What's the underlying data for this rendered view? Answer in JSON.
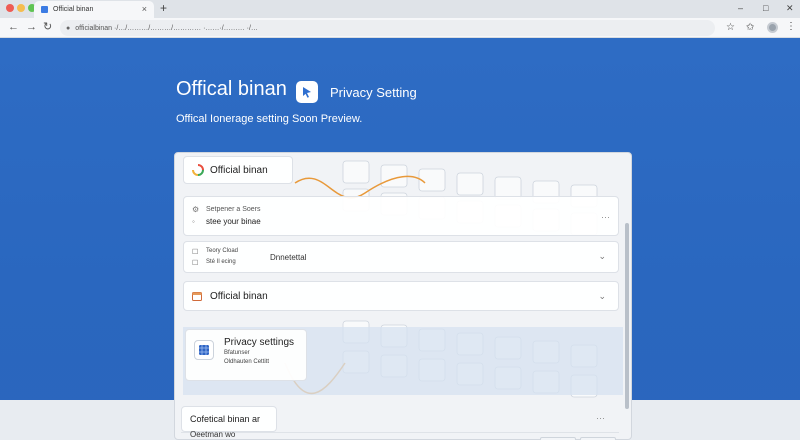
{
  "browser": {
    "tab_title": "Official binan",
    "new_tab_glyph": "+",
    "tab_close_glyph": "×",
    "url": "officialbinan ·/…/………/………/………… ·……·/……… ·/…",
    "window_controls": {
      "minimize": "–",
      "maximize": "□",
      "close": "✕"
    },
    "nav": {
      "back": "←",
      "forward": "→",
      "reload": "↻"
    },
    "toolbar_icons": [
      "star-icon",
      "bookmark-star-icon",
      "avatar",
      "menu-icon"
    ]
  },
  "hero": {
    "title": "Offical binan",
    "logo_icon": "cursor-pointer-icon",
    "privacy_label": "Privacy Setting",
    "subtitle": "Offical Ionerage setting Soon Preview."
  },
  "panel": {
    "card_a": {
      "label": "Official binan",
      "icon": "color-wheel-icon"
    },
    "card_b": {
      "line1": "Setpener a Soers",
      "line2": "stee your binae",
      "more": "···"
    },
    "card_c": {
      "line1": "Teory Cload",
      "line2": "Sté Il ecing",
      "middle": "Dnnetettal",
      "chevron": "⌄"
    },
    "card_d": {
      "label": "Official binan",
      "chevron": "⌄",
      "icon": "calendar-icon"
    },
    "card_e": {
      "title": "Privacy settings",
      "line1": "Bfatunser",
      "line2": "Oldhauten Cettitt",
      "icon": "blue-grid-icon"
    }
  },
  "bottom": {
    "card_title": "Cofetical binan ar",
    "card_sub": "Oeetman wo",
    "more": "···"
  },
  "colors": {
    "page_blue": "#2e6cc4",
    "accent_orange": "#e8993a",
    "chrome_bg": "#dfe3e8"
  }
}
